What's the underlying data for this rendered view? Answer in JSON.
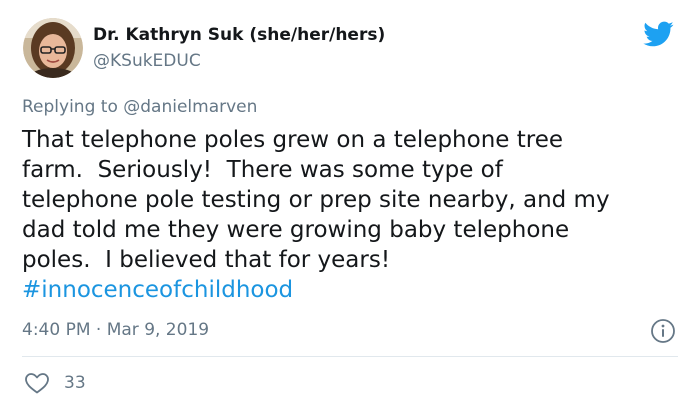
{
  "author": {
    "name": "Dr. Kathryn Suk (she/her/hers)",
    "handle": "@KSukEDUC",
    "avatar_icon": "user-avatar-photo"
  },
  "brand_icon": "twitter-bird-icon",
  "colors": {
    "text_primary": "#14171a",
    "text_secondary": "#657786",
    "link": "#1b95e0",
    "brand": "#1da1f2",
    "divider": "#e1e8ed"
  },
  "reply": {
    "prefix": "Replying to ",
    "mention": "@danielmarven"
  },
  "tweet": {
    "lines": [
      "That telephone poles grew on a telephone tree",
      "farm.  Seriously!  There was some type of",
      "telephone pole testing or prep site nearby, and my",
      "dad told me they were growing baby telephone",
      "poles.  I believed that for years!"
    ],
    "hashtag": "#innocenceofchildhood"
  },
  "meta": {
    "timestamp": "4:40 PM · Mar 9, 2019",
    "info_icon": "info-icon"
  },
  "actions": {
    "like_count": "33",
    "like_icon": "heart-icon"
  }
}
